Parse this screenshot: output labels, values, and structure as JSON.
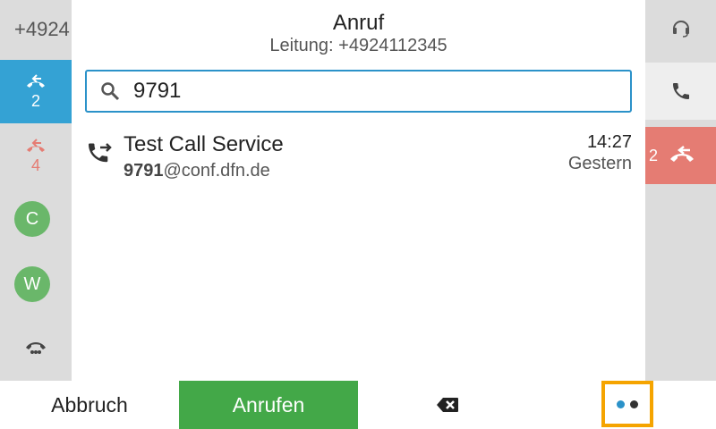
{
  "header": {
    "title": "Anruf",
    "line_label": "Leitung: +4924112345"
  },
  "left_column": {
    "line_number": "+4924",
    "held_call_count": "2",
    "missed_count": "4",
    "avatars": [
      "C",
      "W"
    ]
  },
  "right_column": {
    "active_count": "2"
  },
  "search": {
    "value": "9791"
  },
  "results": [
    {
      "name": "Test Call Service",
      "address_match": "9791",
      "address_rest": "@conf.dfn.de",
      "time": "14:27",
      "date": "Gestern"
    }
  ],
  "softkeys": {
    "cancel_label": "Abbruch",
    "call_label": "Anrufen",
    "backspace_icon": "backspace-icon",
    "more_icon": "more-dots-icon"
  },
  "colors": {
    "held_blue": "#34a2d4",
    "missed_red": "#e57c73",
    "call_green": "#43a848",
    "focus_orange": "#f5a400",
    "search_border": "#2b92c9",
    "avatar_green": "#6ab76a"
  }
}
